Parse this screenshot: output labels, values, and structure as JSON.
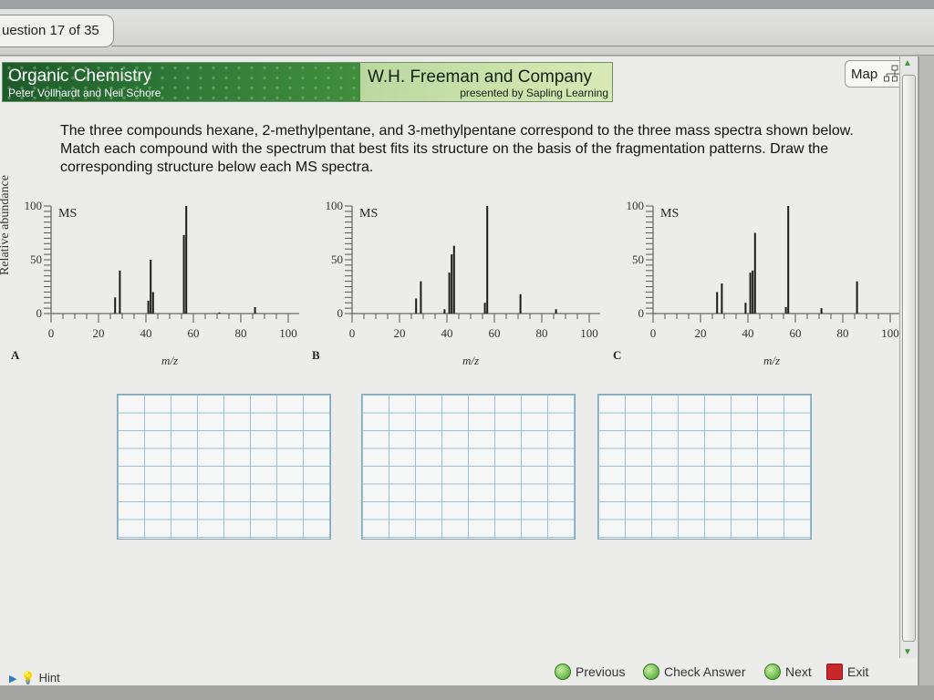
{
  "tab": {
    "label": "uestion 17 of 35"
  },
  "banner": {
    "title": "Organic Chemistry",
    "authors": "Peter Vollhardt and Neil Schore",
    "publisher": "W.H. Freeman and Company",
    "presented_by": "presented by Sapling Learning"
  },
  "map_button": {
    "label": "Map"
  },
  "question": {
    "text": "The three compounds hexane, 2-methylpentane, and 3-methylpentane correspond to the three mass spectra shown below. Match each compound with the spectrum that best fits its structure on the basis of the fragmentation patterns. Draw the corresponding structure below each MS spectra."
  },
  "chart_data": [
    {
      "type": "bar",
      "panel": "A",
      "title": "MS",
      "xlabel": "m/z",
      "ylabel": "Relative abundance",
      "xlim": [
        0,
        100
      ],
      "ylim": [
        0,
        100
      ],
      "xticks": [
        "0",
        "20",
        "40",
        "60",
        "80",
        "100"
      ],
      "yticks": [
        "0",
        "50",
        "100"
      ],
      "x": [
        27,
        29,
        41,
        42,
        43,
        56,
        57,
        71,
        86
      ],
      "values": [
        15,
        40,
        12,
        50,
        20,
        73,
        100,
        1,
        6
      ]
    },
    {
      "type": "bar",
      "panel": "B",
      "title": "MS",
      "xlabel": "m/z",
      "ylabel": "",
      "xlim": [
        0,
        100
      ],
      "ylim": [
        0,
        100
      ],
      "xticks": [
        "0",
        "20",
        "40",
        "60",
        "80",
        "100"
      ],
      "yticks": [
        "0",
        "50",
        "100"
      ],
      "x": [
        27,
        29,
        39,
        41,
        42,
        43,
        56,
        57,
        71,
        86
      ],
      "values": [
        14,
        30,
        4,
        38,
        55,
        63,
        10,
        100,
        18,
        4
      ]
    },
    {
      "type": "bar",
      "panel": "C",
      "title": "MS",
      "xlabel": "m/z",
      "ylabel": "",
      "xlim": [
        0,
        100
      ],
      "ylim": [
        0,
        100
      ],
      "xticks": [
        "0",
        "20",
        "40",
        "60",
        "80",
        "100"
      ],
      "yticks": [
        "0",
        "50",
        "100"
      ],
      "x": [
        27,
        29,
        39,
        41,
        42,
        43,
        56,
        57,
        71,
        86
      ],
      "values": [
        20,
        28,
        10,
        38,
        40,
        75,
        6,
        100,
        5,
        30
      ]
    }
  ],
  "bottom": {
    "hint": "Hint",
    "previous": "Previous",
    "check": "Check Answer",
    "next": "Next",
    "exit": "Exit"
  }
}
